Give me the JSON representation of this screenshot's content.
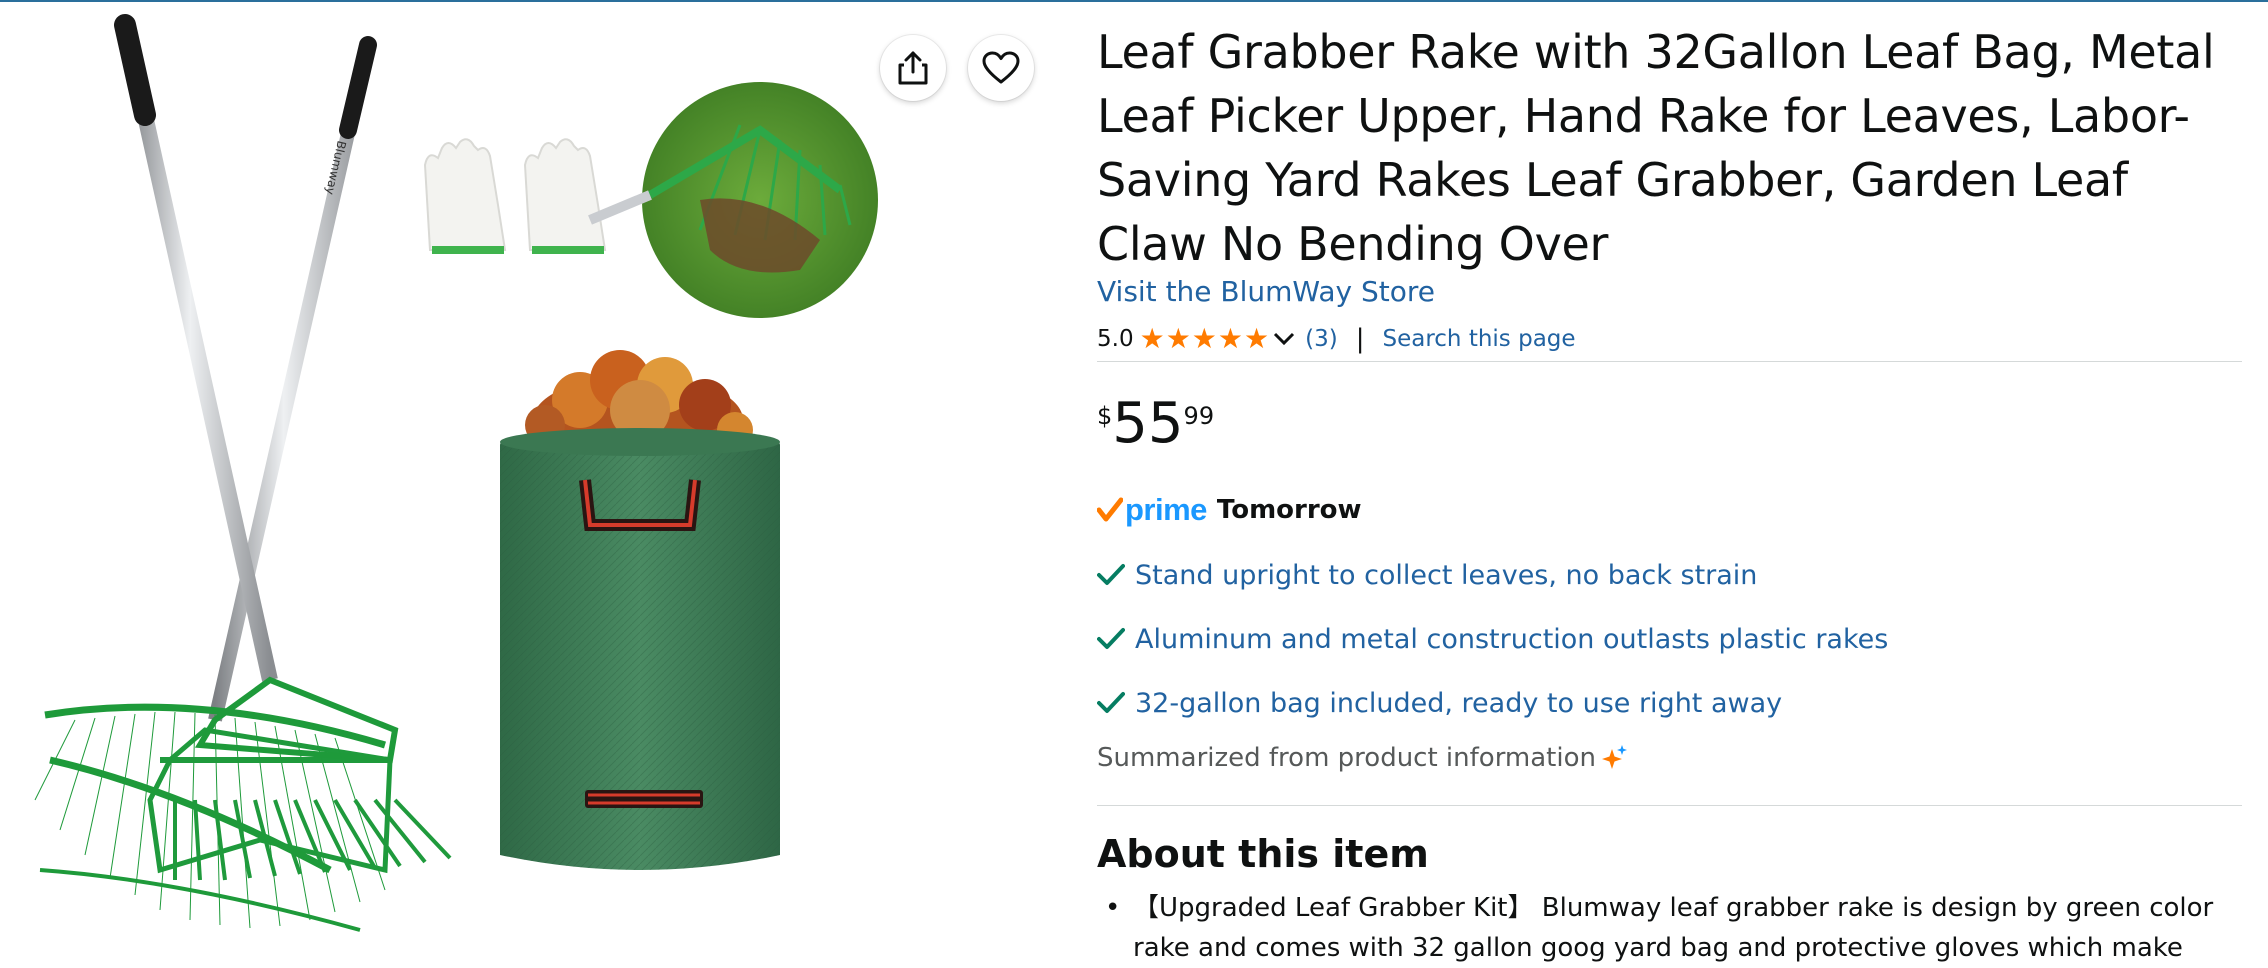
{
  "product": {
    "title": "Leaf Grabber Rake with 32Gallon Leaf Bag, Metal Leaf Picker Upper, Hand Rake for Leaves, Labor-Saving Yard Rakes Leaf Grabber, Garden Leaf Claw No Bending Over",
    "store_link": "Visit the BlumWay Store",
    "rake_brand_text": "Blumway",
    "rating": {
      "value": "5.0",
      "stars_filled": 5,
      "count": "(3)",
      "search_link": "Search this page",
      "star_color": "#ff7b00"
    },
    "price": {
      "symbol": "$",
      "whole": "55",
      "fraction": "99"
    },
    "prime": {
      "word": "prime",
      "delivery": "Tomorrow",
      "check_color": "#ff7b00",
      "word_color": "#1a98ff"
    },
    "highlights": [
      "Stand upright to collect leaves, no back strain",
      "Aluminum and metal construction outlasts plastic rakes",
      "32-gallon bag included, ready to use right away"
    ],
    "summary_note": "Summarized from product information",
    "about": {
      "heading": "About this item",
      "items": [
        "【Upgraded Leaf Grabber Kit】 Blumway leaf grabber rake is design by green color rake and comes with 32 gallon goog yard bag and protective gloves which make"
      ]
    }
  },
  "icons": {
    "share": "share-icon",
    "favorite": "heart-icon",
    "check": "checkmark-icon",
    "sparkle": "sparkle-icon"
  },
  "colors": {
    "link": "#2162a1",
    "accent_green": "#1e8f3a",
    "bag_green": "#3f7d56",
    "check_teal": "#067d62"
  }
}
